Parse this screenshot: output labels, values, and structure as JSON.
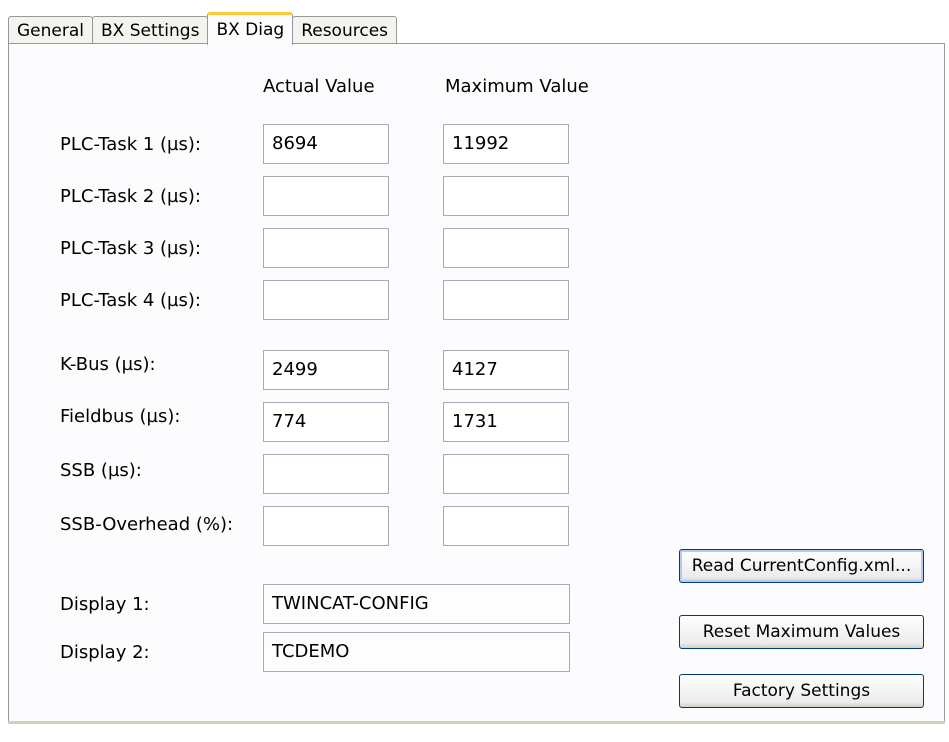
{
  "tabs": [
    {
      "label": "General"
    },
    {
      "label": "BX Settings"
    },
    {
      "label": "BX Diag",
      "active": true
    },
    {
      "label": "Resources"
    }
  ],
  "columns": {
    "actual": "Actual Value",
    "maximum": "Maximum Value"
  },
  "rows": [
    {
      "label": "PLC-Task 1 (µs):",
      "actual": "8694",
      "maximum": "11992"
    },
    {
      "label": "PLC-Task 2 (µs):",
      "actual": "",
      "maximum": ""
    },
    {
      "label": "PLC-Task 3 (µs):",
      "actual": "",
      "maximum": ""
    },
    {
      "label": "PLC-Task 4 (µs):",
      "actual": "",
      "maximum": ""
    },
    {
      "label": "K-Bus (µs):",
      "actual": "2499",
      "maximum": "4127"
    },
    {
      "label": "Fieldbus (µs):",
      "actual": "774",
      "maximum": "1731"
    },
    {
      "label": "SSB (µs):",
      "actual": "",
      "maximum": ""
    },
    {
      "label": "SSB-Overhead (%):",
      "actual": "",
      "maximum": ""
    }
  ],
  "displays": [
    {
      "label": "Display 1:",
      "value": "TWINCAT-CONFIG"
    },
    {
      "label": "Display 2:",
      "value": "TCDEMO"
    }
  ],
  "buttons": {
    "read_config": "Read CurrentConfig.xml...",
    "reset_max": "Reset Maximum Values",
    "factory": "Factory Settings"
  },
  "colors": {
    "active_tab_accent": "#ffc83c",
    "button_border": "#003c74"
  }
}
